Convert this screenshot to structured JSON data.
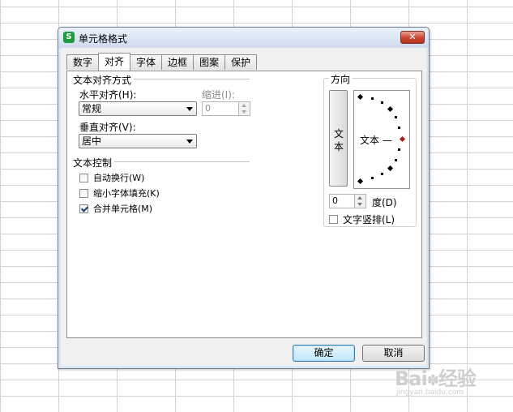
{
  "dialog": {
    "title": "单元格格式",
    "app_icon_letter": "S",
    "close_glyph": "✕"
  },
  "tabs": [
    {
      "label": "数字"
    },
    {
      "label": "对齐"
    },
    {
      "label": "字体"
    },
    {
      "label": "边框"
    },
    {
      "label": "图案"
    },
    {
      "label": "保护"
    }
  ],
  "active_tab": "对齐",
  "text_alignment": {
    "group_label": "文本对齐方式",
    "horizontal_label": "水平对齐(H):",
    "horizontal_value": "常规",
    "indent_label": "缩进(I):",
    "indent_value": "0",
    "vertical_label": "垂直对齐(V):",
    "vertical_value": "居中"
  },
  "text_control": {
    "group_label": "文本控制",
    "options": [
      {
        "label": "自动换行(W)",
        "checked": false
      },
      {
        "label": "缩小字体填充(K)",
        "checked": false
      },
      {
        "label": "合并单元格(M)",
        "checked": true
      }
    ]
  },
  "orientation": {
    "group_label": "方向",
    "vertical_text": [
      "文",
      "本"
    ],
    "preview_text": "文本 —",
    "degree_value": "0",
    "degree_label": "度(D)",
    "vertical_stack_label": "文字竖排(L)",
    "vertical_stack_checked": false
  },
  "buttons": {
    "ok": "确定",
    "cancel": "取消"
  },
  "watermark": {
    "brand": "Bai",
    "brand_end": "经验",
    "url": "jingyan.baidu.com"
  },
  "colors": {
    "accent": "#1e9b3a",
    "close_button": "#c7452f",
    "indicator": "#a0261d"
  },
  "icons": [
    "app-logo-icon",
    "close-icon",
    "dropdown-arrow-icon",
    "spinner-arrows-icon",
    "checkbox-icon",
    "paw-icon"
  ]
}
